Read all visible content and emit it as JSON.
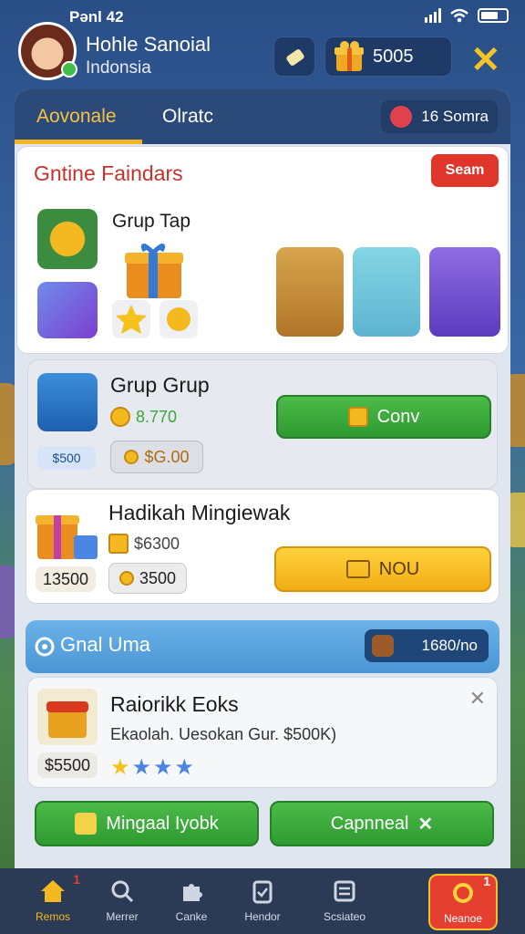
{
  "status": {
    "time": "Pənl 42"
  },
  "header": {
    "user_name": "Hohle Sanoial",
    "user_country": "Indonsia",
    "coins": "5005"
  },
  "tabs": {
    "items": [
      {
        "label": "Aovonale",
        "active": true
      },
      {
        "label": "Olratc",
        "active": false
      }
    ],
    "counter": "16 Somra"
  },
  "section1": {
    "title": "Gntine Faindars",
    "action_label": "Seam",
    "group_label": "Grup Tap"
  },
  "row_group": {
    "title": "Grup Grup",
    "amount": "8.770",
    "badge_value": "$500",
    "chip_value": "$G.00",
    "button_label": "Conv"
  },
  "row_gift": {
    "title": "Hadikah Mingiewak",
    "amount": "$6300",
    "price_value": "13500",
    "chip_value": "3500",
    "button_label": "NOU"
  },
  "section2": {
    "title": "Gnal Uma",
    "counter": "1680/no"
  },
  "row_reward": {
    "title": "Raiorikk Eoks",
    "description": "Ekaolah. Uesokan Gur. $500K)",
    "price": "$5500",
    "stars": 3
  },
  "actions": {
    "left_label": "Mingaal Iyobk",
    "right_label": "Capnneal"
  },
  "nav": {
    "items": [
      {
        "label": "Remos",
        "icon": "home-icon",
        "badge": "1"
      },
      {
        "label": "Merrer",
        "icon": "search-icon"
      },
      {
        "label": "Canke",
        "icon": "puzzle-icon"
      },
      {
        "label": "Hendor",
        "icon": "clipboard-icon"
      },
      {
        "label": "Scsiateo",
        "icon": "list-icon"
      },
      {
        "label": "Neanoe",
        "icon": "ring-icon",
        "badge": "1"
      }
    ]
  },
  "colors": {
    "accent_red": "#e0352b",
    "accent_green": "#3aa83a",
    "accent_yellow": "#f5b521",
    "panel_dark": "#2b4a7a"
  }
}
